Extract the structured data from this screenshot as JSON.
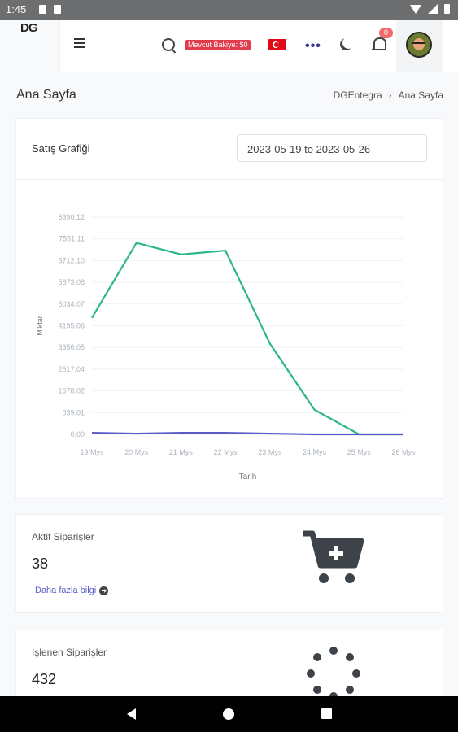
{
  "status_bar": {
    "time": "1:45"
  },
  "header": {
    "logo": "DG",
    "balance_label": "Mevcut Bakiye: $0",
    "notification_count": "0",
    "moon_icon": "moon-icon",
    "bell_icon": "bell-icon"
  },
  "page": {
    "title": "Ana Sayfa",
    "breadcrumb": [
      "DGEntegra",
      "Ana Sayfa"
    ]
  },
  "sales_chart": {
    "title": "Satış Grafiği",
    "date_range": "2023-05-19 to 2023-05-26"
  },
  "chart_data": {
    "type": "line",
    "x": [
      "19 Mys",
      "20 Mys",
      "21 Mys",
      "22 Mys",
      "23 Mys",
      "24 Mys",
      "25 Mys",
      "26 Mys"
    ],
    "yticks": [
      "0.00",
      "839.01",
      "1678.02",
      "2517.04",
      "3356.05",
      "4195.06",
      "5034.07",
      "5873.08",
      "6712.10",
      "7551.11",
      "8390.12"
    ],
    "ylim": [
      0,
      8390.12
    ],
    "xlabel": "Tarih",
    "ylabel": "Miktar",
    "series": [
      {
        "color": "#2cb786",
        "values": [
          4500,
          7400,
          6950,
          7100,
          3500,
          950,
          0,
          0
        ]
      },
      {
        "color": "#5c5cc8",
        "values": [
          60,
          30,
          60,
          60,
          30,
          0,
          0,
          0
        ]
      }
    ]
  },
  "active_orders": {
    "label": "Aktif Siparişler",
    "value": "38",
    "link": "Daha fazla bilgi",
    "icon": "cart-plus-icon"
  },
  "processing_orders": {
    "label": "İşlenen Siparişler",
    "value": "432",
    "icon": "spinner-icon"
  }
}
